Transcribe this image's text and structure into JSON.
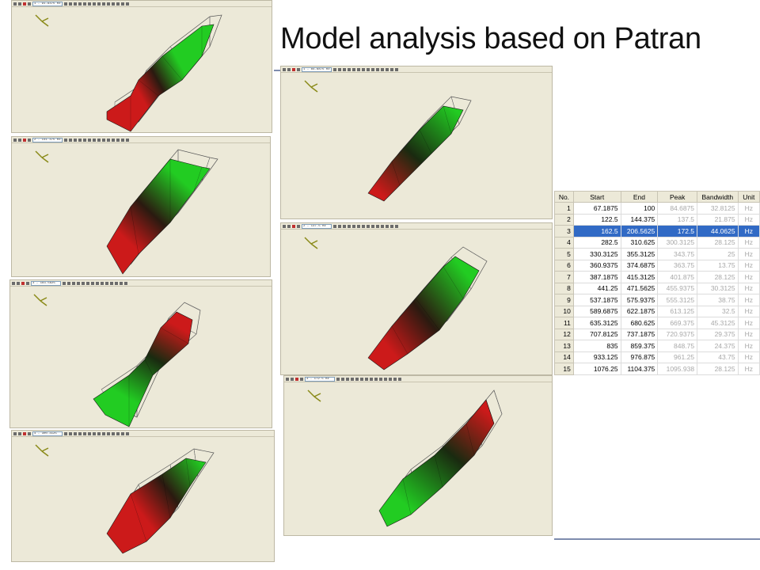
{
  "slide": {
    "title": "Model analysis based on Patran"
  },
  "panels": [
    {
      "id": "mode-1",
      "selector": "1 - 91.9375 Hz"
    },
    {
      "id": "mode-2",
      "selector": "2 - 141.375 Hz"
    },
    {
      "id": "mode-3",
      "selector": "3 - 183.5625 Hz"
    },
    {
      "id": "mode-4",
      "selector": "4 - 300.3125 Hz"
    },
    {
      "id": "mode-5",
      "selector": "1 - 84.6875 Hz"
    },
    {
      "id": "mode-6",
      "selector": "2 - 137.5 Hz"
    },
    {
      "id": "mode-7",
      "selector": "3 - 172.5 Hz"
    }
  ],
  "colors": {
    "accent_rule": "#7e8cae",
    "selection": "#316ac5",
    "mode_red": "#cc1a1a",
    "mode_green": "#22cc22"
  },
  "table": {
    "columns": [
      "No.",
      "Start",
      "End",
      "Peak",
      "Bandwidth",
      "Unit"
    ],
    "selected_row": 3,
    "rows": [
      [
        "1",
        "67.1875",
        "100",
        "84.6875",
        "32.8125",
        "Hz"
      ],
      [
        "2",
        "122.5",
        "144.375",
        "137.5",
        "21.875",
        "Hz"
      ],
      [
        "3",
        "162.5",
        "206.5625",
        "172.5",
        "44.0625",
        "Hz"
      ],
      [
        "4",
        "282.5",
        "310.625",
        "300.3125",
        "28.125",
        "Hz"
      ],
      [
        "5",
        "330.3125",
        "355.3125",
        "343.75",
        "25",
        "Hz"
      ],
      [
        "6",
        "360.9375",
        "374.6875",
        "363.75",
        "13.75",
        "Hz"
      ],
      [
        "7",
        "387.1875",
        "415.3125",
        "401.875",
        "28.125",
        "Hz"
      ],
      [
        "8",
        "441.25",
        "471.5625",
        "455.9375",
        "30.3125",
        "Hz"
      ],
      [
        "9",
        "537.1875",
        "575.9375",
        "555.3125",
        "38.75",
        "Hz"
      ],
      [
        "10",
        "589.6875",
        "622.1875",
        "613.125",
        "32.5",
        "Hz"
      ],
      [
        "11",
        "635.3125",
        "680.625",
        "669.375",
        "45.3125",
        "Hz"
      ],
      [
        "12",
        "707.8125",
        "737.1875",
        "720.9375",
        "29.375",
        "Hz"
      ],
      [
        "13",
        "835",
        "859.375",
        "848.75",
        "24.375",
        "Hz"
      ],
      [
        "14",
        "933.125",
        "976.875",
        "961.25",
        "43.75",
        "Hz"
      ],
      [
        "15",
        "1076.25",
        "1104.375",
        "1095.938",
        "28.125",
        "Hz"
      ]
    ]
  }
}
